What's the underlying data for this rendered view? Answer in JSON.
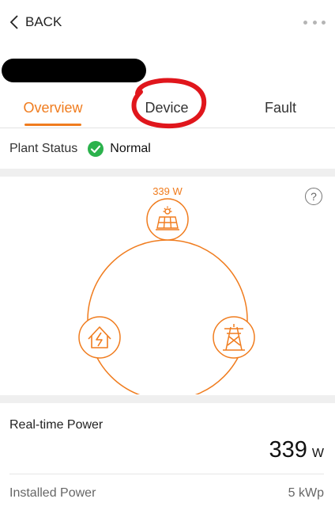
{
  "header": {
    "back_label": "BACK"
  },
  "tabs": [
    {
      "label": "Overview",
      "active": true
    },
    {
      "label": "Device",
      "active": false
    },
    {
      "label": "Fault",
      "active": false
    }
  ],
  "plant_status": {
    "label": "Plant Status",
    "value": "Normal",
    "color": "#2bb24c"
  },
  "flow": {
    "pv_power": "339 W",
    "help": "?"
  },
  "realtime": {
    "title": "Real-time Power",
    "value": "339",
    "unit": "W",
    "installed_label": "Installed Power",
    "installed_value": "5 kWp"
  },
  "colors": {
    "accent": "#f07c1e",
    "annotation": "#e0161c",
    "status_ok": "#2bb24c"
  },
  "icons": [
    "back-chevron-icon",
    "more-icon",
    "check-circle-icon",
    "help-icon",
    "solar-panel-icon",
    "home-icon",
    "grid-tower-icon"
  ]
}
